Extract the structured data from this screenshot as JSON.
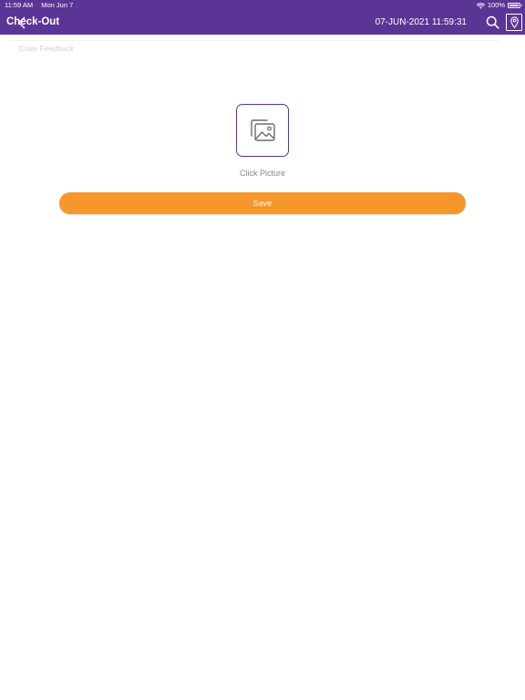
{
  "status_bar": {
    "time": "11:59 AM",
    "date": "Mon Jun 7",
    "battery": "100%",
    "icons": [
      "wifi-icon",
      "battery-icon"
    ]
  },
  "header": {
    "title": "Check-Out",
    "datetime": "07-JUN-2021 11:59:31",
    "icons": [
      "back-arrow-icon",
      "search-icon",
      "location-pin-icon"
    ]
  },
  "feedback": {
    "value": "",
    "placeholder": "Enter Feedback"
  },
  "picture": {
    "label": "Click Picture",
    "icon": "image-gallery-icon"
  },
  "save": {
    "label": "Save"
  },
  "colors": {
    "header_bg": "#5b3595",
    "accent": "#f5972a",
    "picture_border": "#5b3595"
  }
}
